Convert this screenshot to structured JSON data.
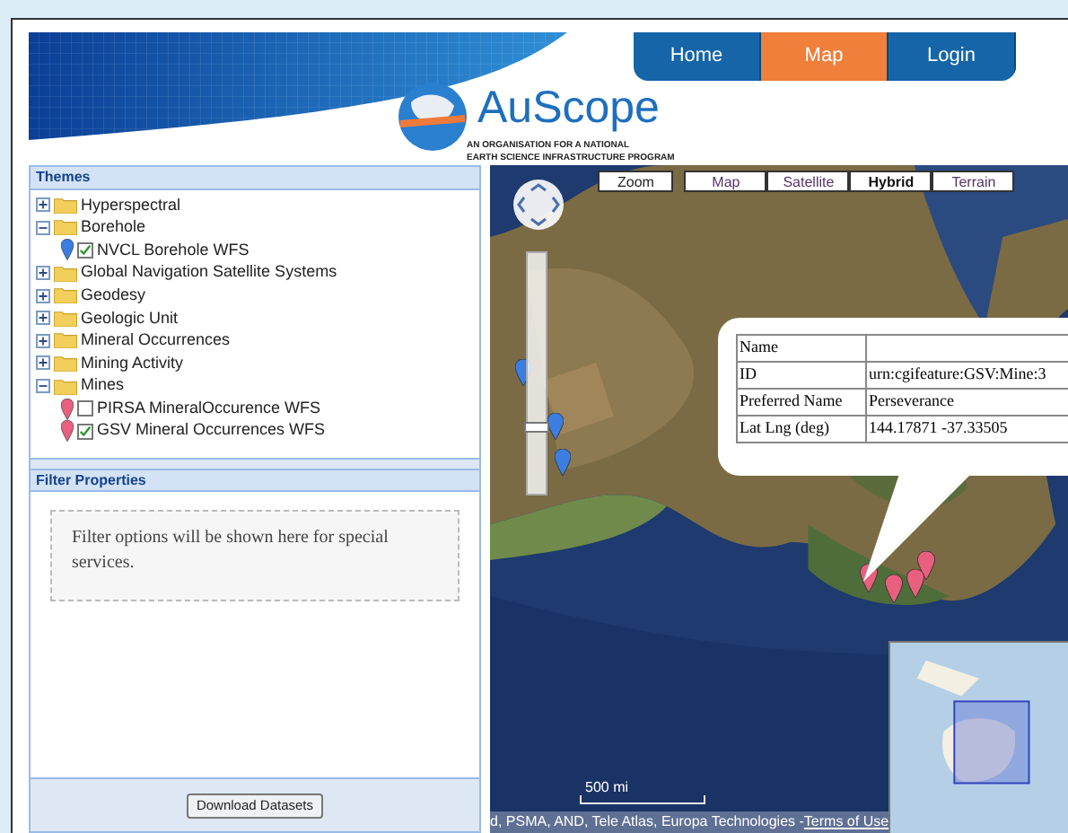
{
  "nav": [
    {
      "label": "Home",
      "selected": false
    },
    {
      "label": "Map",
      "selected": true
    },
    {
      "label": "Login",
      "selected": false
    }
  ],
  "logo": {
    "name": "AuScope",
    "tagline_1": "AN ORGANISATION FOR A NATIONAL",
    "tagline_2": "EARTH SCIENCE INFRASTRUCTURE PROGRAM"
  },
  "themes": {
    "title": "Themes",
    "items": [
      {
        "kind": "folder",
        "label": "Hyperspectral",
        "expanded": false
      },
      {
        "kind": "folder",
        "label": "Borehole",
        "expanded": true,
        "children": [
          {
            "kind": "layer",
            "label": "NVCL Borehole WFS",
            "checked": true,
            "color": "#3b7de0"
          }
        ]
      },
      {
        "kind": "folder",
        "label": "Global Navigation Satellite Systems",
        "expanded": false
      },
      {
        "kind": "folder",
        "label": "Geodesy",
        "expanded": false
      },
      {
        "kind": "folder",
        "label": "Geologic Unit",
        "expanded": false
      },
      {
        "kind": "folder",
        "label": "Mineral Occurrences",
        "expanded": false
      },
      {
        "kind": "folder",
        "label": "Mining Activity",
        "expanded": false
      },
      {
        "kind": "folder",
        "label": "Mines",
        "expanded": true,
        "children": [
          {
            "kind": "layer",
            "label": "PIRSA MineralOccurence WFS",
            "checked": false,
            "color": "#e8607e"
          },
          {
            "kind": "layer",
            "label": "GSV Mineral Occurrences WFS",
            "checked": true,
            "color": "#e8607e"
          }
        ]
      }
    ]
  },
  "filter": {
    "title": "Filter Properties",
    "message": "Filter options will be shown here for special services."
  },
  "download_button": "Download Datasets",
  "map": {
    "zoom_label": "Zoom",
    "zoom_slider": {
      "level": 0.28
    },
    "types": [
      {
        "label": "Map",
        "selected": false
      },
      {
        "label": "Satellite",
        "selected": false
      },
      {
        "label": "Hybrid",
        "selected": true
      },
      {
        "label": "Terrain",
        "selected": false
      }
    ],
    "info_window": {
      "rows": [
        {
          "label": "Name"
        },
        {
          "label": "ID",
          "value": "urn:cgifeature:GSV:Mine:3"
        },
        {
          "label": "Preferred Name",
          "value": "Perseverance"
        },
        {
          "label": "Lat Lng (deg)",
          "value": "144.17871 -37.33505"
        }
      ]
    },
    "scale": "500 mi",
    "attribution": "d, PSMA, AND, Tele Atlas, Europa Technologies - ",
    "terms_link": "Terms of Use"
  }
}
